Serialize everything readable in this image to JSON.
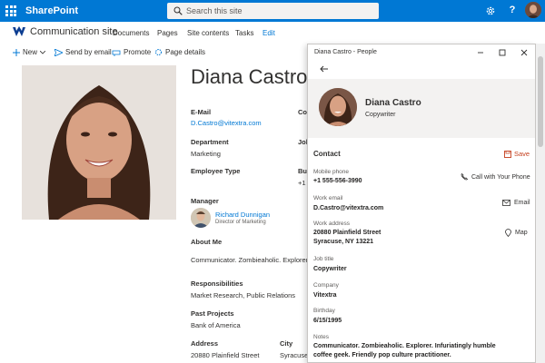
{
  "suitebar": {
    "brand": "SharePoint",
    "search_placeholder": "Search this site",
    "help": "?"
  },
  "site": {
    "name": "Communication site",
    "nav": [
      "Documents",
      "Pages",
      "Site contents",
      "Tasks",
      "Edit"
    ]
  },
  "commands": {
    "new": "New",
    "send": "Send by email",
    "promote": "Promote",
    "details": "Page details"
  },
  "profile": {
    "name": "Diana Castro",
    "email_label": "E-Mail",
    "email": "D.Castro@vitextra.com",
    "department_label": "Department",
    "department": "Marketing",
    "employee_type_label": "Employee Type",
    "manager_label": "Manager",
    "manager_name": "Richard Dunnigan",
    "manager_title": "Director of Marketing",
    "about_label": "About Me",
    "about": "Communicator. Zombieaholic. Explorer. In",
    "responsibilities_label": "Responsibilities",
    "responsibilities": "Market Research, Public Relations",
    "projects_label": "Past Projects",
    "projects": "Bank of America",
    "address_label": "Address",
    "address": "20880 Plainfield Street",
    "city_label": "City",
    "city": "Syracuse",
    "clipped": {
      "co": "Co",
      "job": "Job",
      "bus": "Bus",
      "plus1": "+1"
    }
  },
  "people_window": {
    "title": "Diana Castro - People",
    "name": "Diana Castro",
    "role": "Copywriter",
    "contact_heading": "Contact",
    "save": "Save",
    "fields": {
      "mobile_label": "Mobile phone",
      "mobile": "+1 555-556-3990",
      "work_email_label": "Work email",
      "work_email": "D.Castro@vitextra.com",
      "address_label": "Work address",
      "address_line1": "20880 Plainfield Street",
      "address_line2": "Syracuse, NY 13221",
      "job_label": "Job title",
      "job": "Copywriter",
      "company_label": "Company",
      "company": "Vitextra",
      "birthday_label": "Birthday",
      "birthday": "6/15/1995",
      "notes_label": "Notes",
      "notes_line1": "Communicator. Zombieaholic. Explorer. Infuriatingly humble",
      "notes_line2": "coffee geek. Friendly pop culture practitioner."
    },
    "actions": {
      "call": "Call with Your Phone",
      "email": "Email",
      "map": "Map"
    }
  },
  "colors": {
    "suitebar": "#0078d4",
    "link": "#0078d4",
    "save": "#c43e1c"
  }
}
